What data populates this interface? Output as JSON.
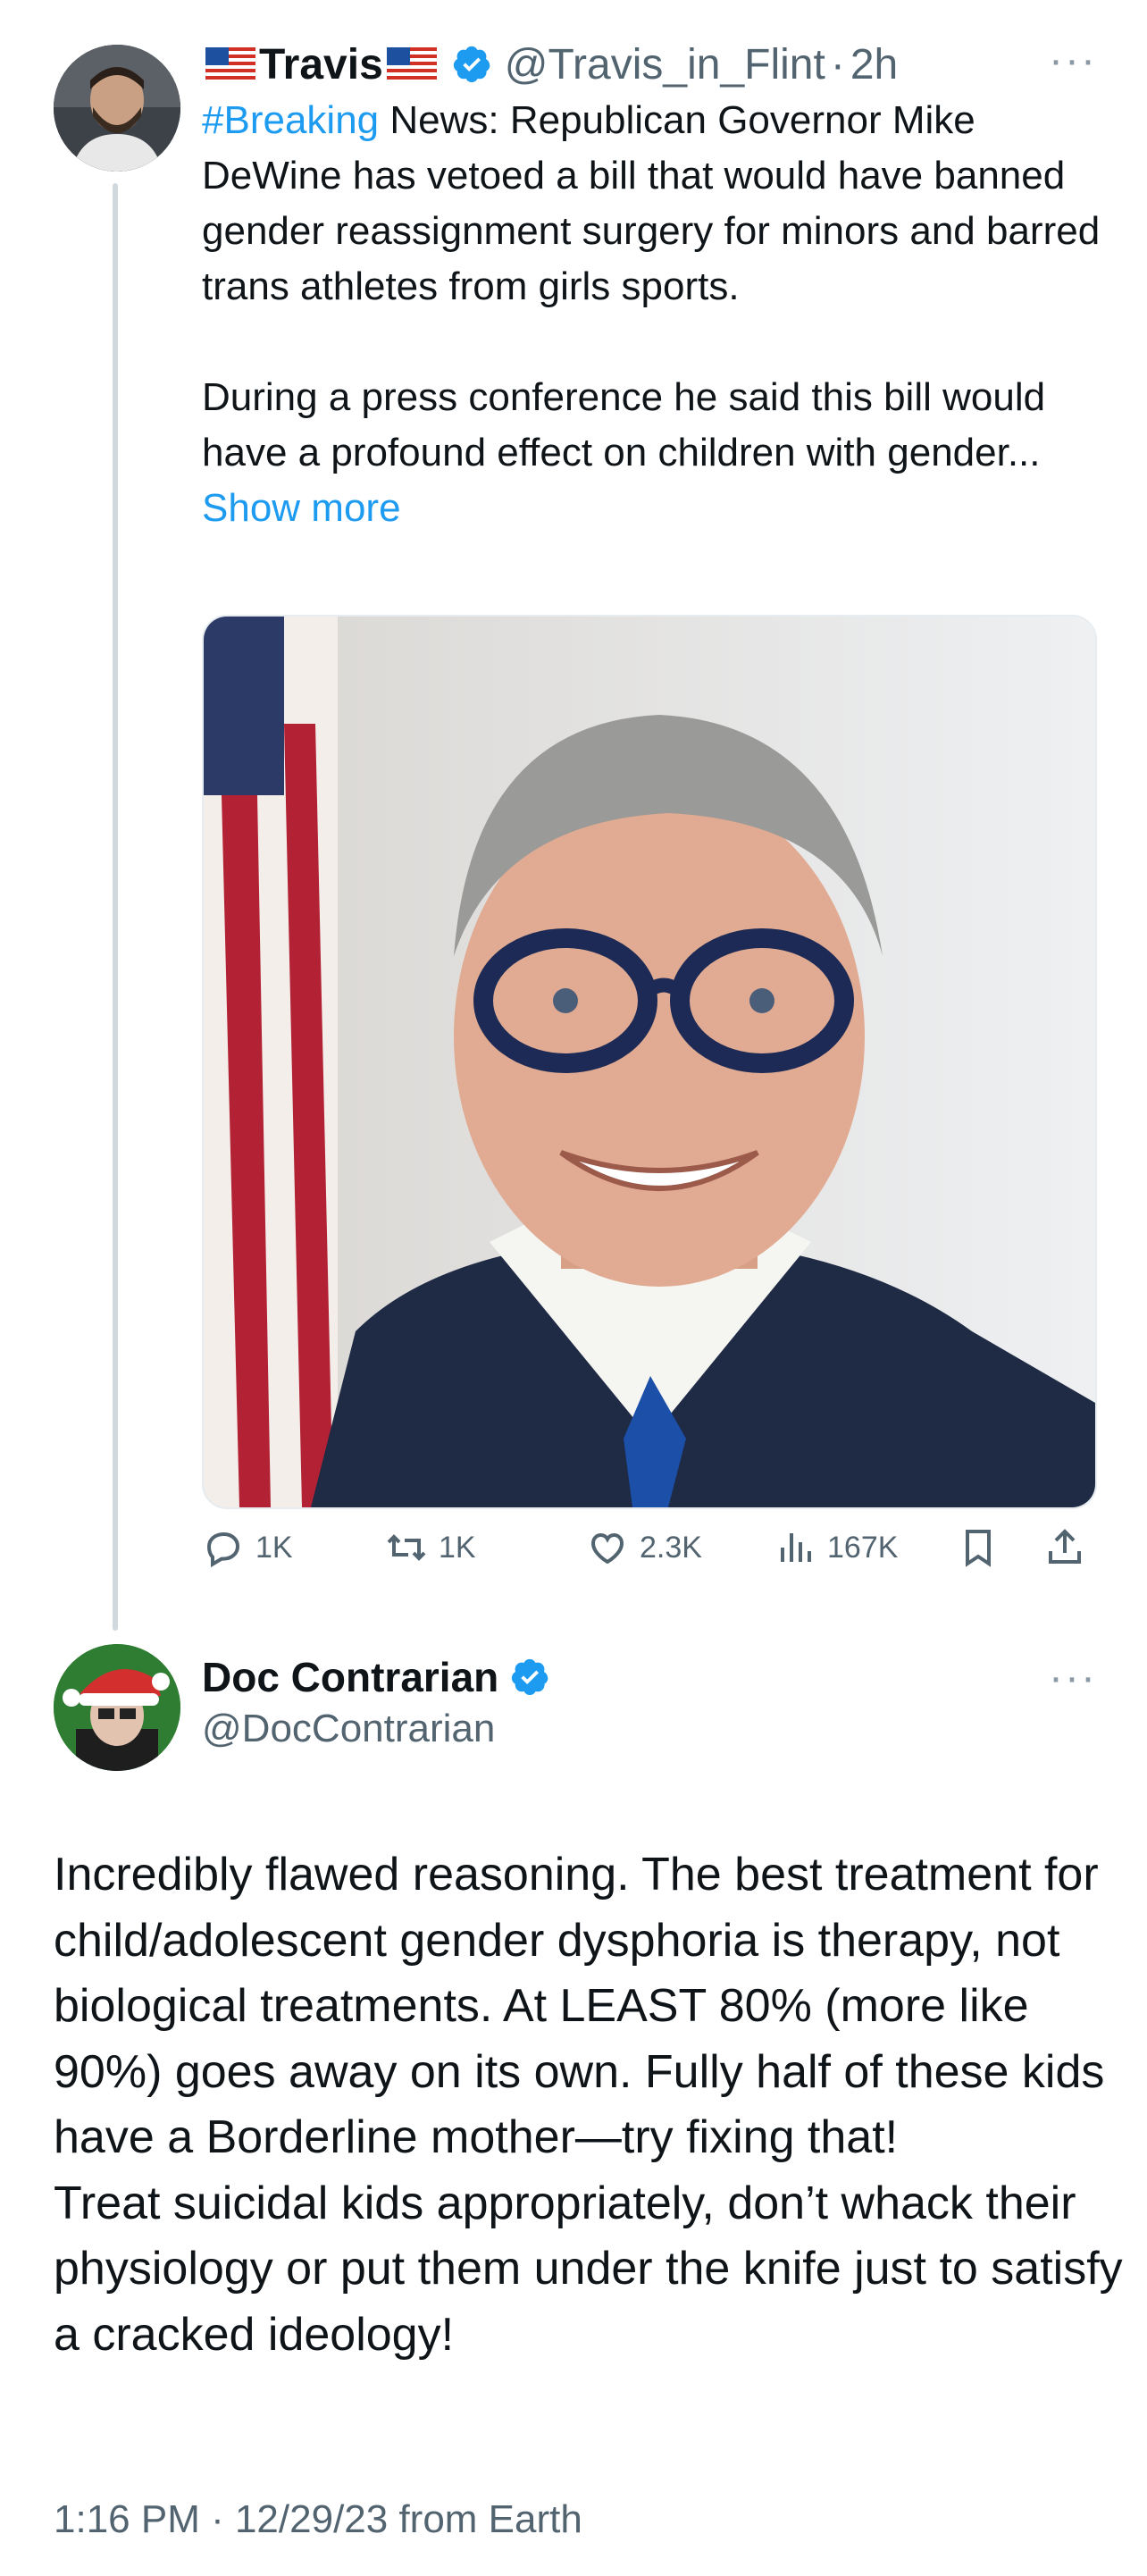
{
  "tweet": {
    "author_name": "Travis",
    "handle": "@Travis_in_Flint",
    "separator": "·",
    "time": "2h",
    "more_menu": "···",
    "hashtag": "#Breaking",
    "text_after_hashtag": " News: Republican Governor Mike DeWine has vetoed a bill that would have banned gender reassignment surgery for minors and barred trans athletes from girls sports.\n\nDuring a press conference he said this bill would have a profound effect on children with gender... ",
    "show_more": "Show more",
    "media_alt": "Portrait of Governor Mike DeWine in front of an American flag",
    "actions": {
      "replies": "1K",
      "retweets": "1K",
      "likes": "2.3K",
      "views": "167K"
    }
  },
  "reply": {
    "author_name": "Doc Contrarian",
    "handle": "@DocContrarian",
    "more_menu": "···",
    "text": "Incredibly flawed reasoning. The best treatment for child/adolescent gender dysphoria is therapy, not biological treatments. At LEAST 80% (more like 90%) goes away on its own. Fully half of these kids have a Borderline mother—try fixing that!\nTreat suicidal kids appropriately, don’t whack their physiology or put them under the knife just to satisfy a cracked ideology!",
    "timestamp": "1:16 PM · 12/29/23 from Earth"
  },
  "colors": {
    "accent": "#1d9bf0",
    "secondary_text": "#536471",
    "thread_line": "#cfd9de"
  },
  "icons": [
    "reply-icon",
    "retweet-icon",
    "like-icon",
    "views-icon",
    "bookmark-icon",
    "share-icon",
    "verified-badge-icon",
    "us-flag-icon"
  ]
}
